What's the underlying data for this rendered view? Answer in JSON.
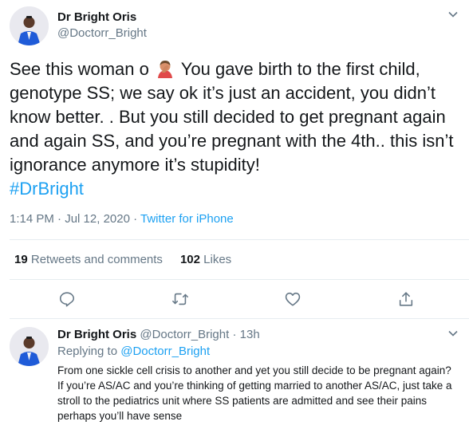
{
  "main_tweet": {
    "author_name": "Dr Bright Oris",
    "author_handle": "@Doctorr_Bright",
    "avatar_icon": "profile-photo",
    "text_before_emoji": "See this woman o",
    "emoji": "person-facepalming-icon",
    "text_after_emoji": " You gave birth to the first child, genotype SS; we say ok it’s just an accident, you didn’t know better. . But you still decided to get pregnant again and again SS, and you’re pregnant with the 4th.. this isn’t ignorance anymore it’s stupidity!",
    "hashtag": "#DrBright",
    "time": "1:14 PM",
    "separator": " · ",
    "date": "Jul 12, 2020",
    "source": "Twitter for iPhone",
    "retweets_count": "19",
    "retweets_label": "Retweets and comments",
    "likes_count": "102",
    "likes_label": "Likes"
  },
  "actions": [
    "reply-icon",
    "retweet-icon",
    "like-icon",
    "share-icon"
  ],
  "reply_tweet": {
    "author_name": "Dr Bright Oris",
    "author_handle": "@Doctorr_Bright",
    "time_ago": "13h",
    "replying_label": "Replying to",
    "replying_to": "@Doctorr_Bright",
    "paragraph1": "From one sickle cell crisis to another and yet you still decide to be pregnant again?",
    "paragraph2": "If you’re AS/AC and you’re thinking of getting married to another AS/AC, just take a stroll to the pediatrics unit where SS patients are admitted and see their pains perhaps you’ll have sense"
  },
  "colors": {
    "text": "#14171a",
    "secondary": "#657786",
    "accent": "#1da1f2",
    "divider": "#e6ecf0"
  }
}
